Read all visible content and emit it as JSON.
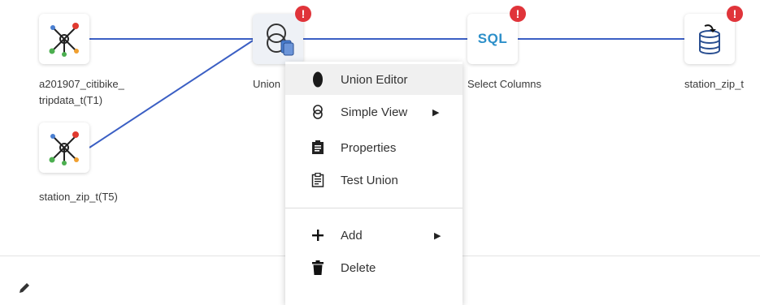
{
  "nodes": {
    "t1": {
      "label_line1": "a201907_citibike_",
      "label_line2": "tripdata_t(T1)",
      "icon": "hub-network-icon"
    },
    "t5": {
      "label": "station_zip_t(T5)",
      "icon": "hub-network-icon"
    },
    "union": {
      "label": "Union",
      "icon": "union-circles-icon",
      "badge": "!"
    },
    "select": {
      "label": "Select Columns",
      "icon_text": "SQL",
      "badge": "!"
    },
    "output": {
      "label": "station_zip_t",
      "icon": "database-download-icon",
      "badge": "!"
    }
  },
  "context_menu": {
    "items": [
      {
        "label": "Union Editor",
        "icon": "union-editor-icon",
        "highlighted": true
      },
      {
        "label": "Simple View",
        "icon": "simple-view-icon",
        "submenu": true
      },
      {
        "label": "Properties",
        "icon": "properties-icon"
      },
      {
        "label": "Test Union",
        "icon": "clipboard-test-icon"
      },
      {
        "label": "Add",
        "icon": "plus-icon",
        "submenu": true
      },
      {
        "label": "Delete",
        "icon": "trash-icon"
      }
    ]
  },
  "colors": {
    "link": "#3b5fc4",
    "badge": "#e0343a",
    "sql": "#2c8fc9"
  }
}
